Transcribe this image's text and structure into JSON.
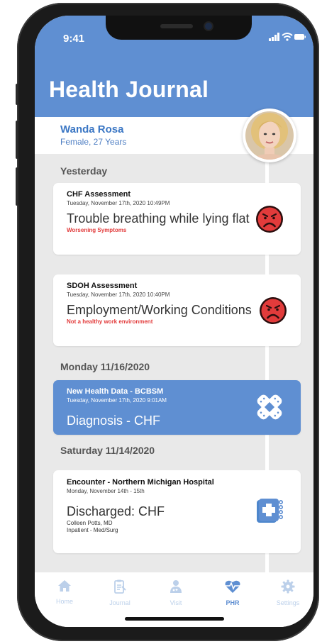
{
  "status": {
    "time": "9:41"
  },
  "header": {
    "title": "Health Journal"
  },
  "patient": {
    "name": "Wanda Rosa",
    "info": "Female, 27 Years"
  },
  "sections": [
    {
      "label": "Yesterday"
    },
    {
      "label": "Monday 11/16/2020"
    },
    {
      "label": "Saturday 11/14/2020"
    }
  ],
  "cards": [
    {
      "title": "CHF Assessment",
      "date": "Tuesday, November 17th, 2020 10:49PM",
      "main": "Trouble breathing while lying flat",
      "sub": "Worsening Symptoms",
      "icon": "sad-face-icon"
    },
    {
      "title": "SDOH Assessment",
      "date": "Tuesday, November 17th, 2020 10:40PM",
      "main": "Employment/Working Conditions",
      "sub": "Not a healthy work environment",
      "icon": "sad-face-icon"
    },
    {
      "title": "New Health Data - BCBSM",
      "date": "Tuesday, November 17th, 2020 9:01AM",
      "main": "Diagnosis - CHF",
      "icon": "bandage-icon"
    },
    {
      "title": "Encounter - Northern Michigan Hospital",
      "date": "Monday, November 14th - 15th",
      "main": "Discharged: CHF",
      "extra1": "Colleen Potts, MD",
      "extra2": "Inpatient - Med/Surg",
      "icon": "medical-binder-icon"
    }
  ],
  "tabs": [
    {
      "label": "Home",
      "icon": "home-icon"
    },
    {
      "label": "Journal",
      "icon": "journal-icon"
    },
    {
      "label": "Visit",
      "icon": "doctor-icon"
    },
    {
      "label": "PHR",
      "icon": "heart-pulse-icon",
      "active": true
    },
    {
      "label": "Settings",
      "icon": "gear-icon"
    }
  ],
  "colors": {
    "primary": "#5f8fd2",
    "alert": "#e23b3b",
    "face": "#e23b3b",
    "background": "#e9e9e9"
  }
}
